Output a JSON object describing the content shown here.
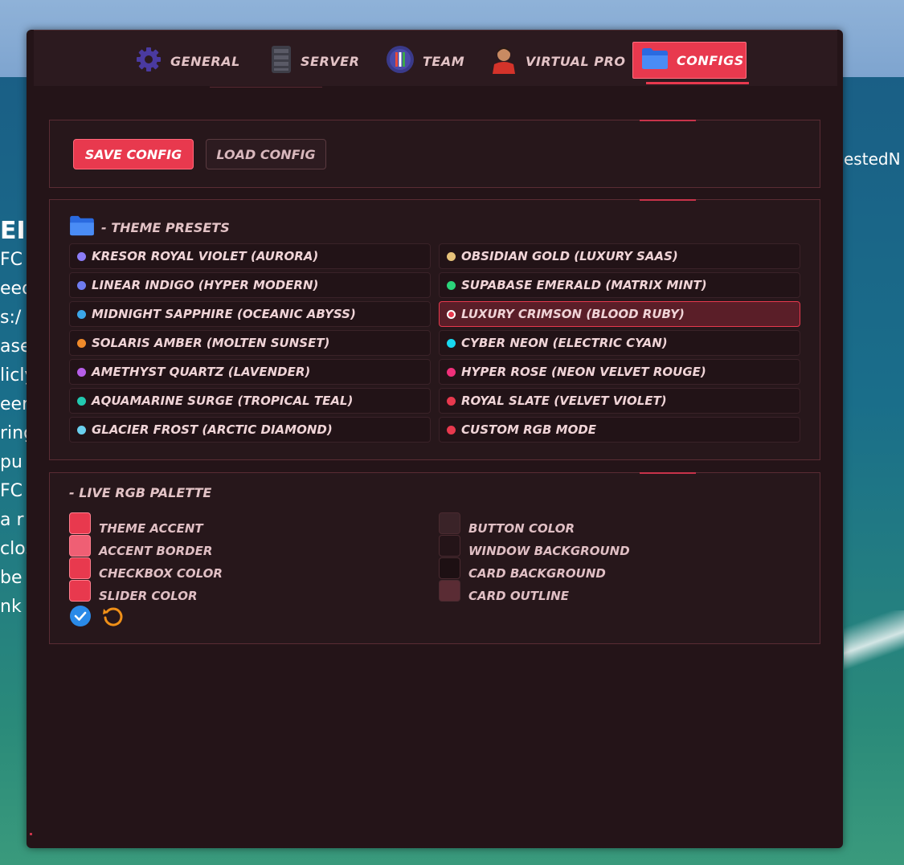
{
  "background": {
    "left_fragments": [
      "EI",
      "FC",
      "eed",
      "s:/",
      "ase",
      "licly",
      "een",
      "ring",
      "pu",
      "FC",
      "a r",
      "clos",
      "be a",
      "nk v"
    ],
    "right_fragment": "estedN"
  },
  "tabs": [
    {
      "label": "GENERAL",
      "icon": "gear-icon",
      "active": false
    },
    {
      "label": "SERVER",
      "icon": "server-icon",
      "active": false
    },
    {
      "label": "TEAM",
      "icon": "team-badge-icon",
      "active": false
    },
    {
      "label": "VIRTUAL PRO",
      "icon": "player-avatar-icon",
      "active": false
    },
    {
      "label": "CONFIGS",
      "icon": "folder-icon",
      "active": true
    }
  ],
  "config_actions": {
    "save_label": "SAVE CONFIG",
    "load_label": "LOAD CONFIG"
  },
  "theme_presets": {
    "title": "- THEME PRESETS",
    "left": [
      {
        "name": "KRESOR ROYAL VIOLET (AURORA)",
        "color": "#8b7cf6"
      },
      {
        "name": "LINEAR INDIGO (HYPER MODERN)",
        "color": "#6f7cf0"
      },
      {
        "name": "MIDNIGHT SAPPHIRE (OCEANIC ABYSS)",
        "color": "#3ba6e8"
      },
      {
        "name": "SOLARIS AMBER (MOLTEN SUNSET)",
        "color": "#f08a2a"
      },
      {
        "name": "AMETHYST QUARTZ (LAVENDER)",
        "color": "#b65ee8"
      },
      {
        "name": "AQUAMARINE SURGE (TROPICAL TEAL)",
        "color": "#22c9b0"
      },
      {
        "name": "GLACIER FROST (ARCTIC DIAMOND)",
        "color": "#6ad0ee"
      }
    ],
    "right": [
      {
        "name": "OBSIDIAN GOLD (LUXURY SAAS)",
        "color": "#e6c27a"
      },
      {
        "name": "SUPABASE EMERALD (MATRIX MINT)",
        "color": "#2bd47a"
      },
      {
        "name": "LUXURY CRIMSON (BLOOD RUBY)",
        "color": "#e8394e"
      },
      {
        "name": "CYBER NEON (ELECTRIC CYAN)",
        "color": "#18d8f0"
      },
      {
        "name": "HYPER ROSE (NEON VELVET ROUGE)",
        "color": "#f0307a"
      },
      {
        "name": "ROYAL SLATE (VELVET VIOLET)",
        "color": "#e8394e"
      },
      {
        "name": "CUSTOM RGB MODE",
        "color": "#e8394e"
      }
    ],
    "active": "LUXURY CRIMSON (BLOOD RUBY)"
  },
  "live_palette": {
    "title": "- LIVE RGB PALETTE",
    "left": [
      {
        "label": "THEME ACCENT",
        "color": "#e8394e"
      },
      {
        "label": "ACCENT BORDER",
        "color": "#ef5f74"
      },
      {
        "label": "CHECKBOX COLOR",
        "color": "#e8394e"
      },
      {
        "label": "SLIDER COLOR",
        "color": "#e8394e"
      }
    ],
    "right": [
      {
        "label": "BUTTON COLOR",
        "color": "#3a2328"
      },
      {
        "label": "WINDOW BACKGROUND",
        "color": "#241418"
      },
      {
        "label": "CARD BACKGROUND",
        "color": "#1d1013"
      },
      {
        "label": "CARD OUTLINE",
        "color": "#5a2c34"
      }
    ]
  },
  "colors": {
    "accent": "#e8394e",
    "window_bg": "#241418",
    "text": "#e3c3c6"
  }
}
